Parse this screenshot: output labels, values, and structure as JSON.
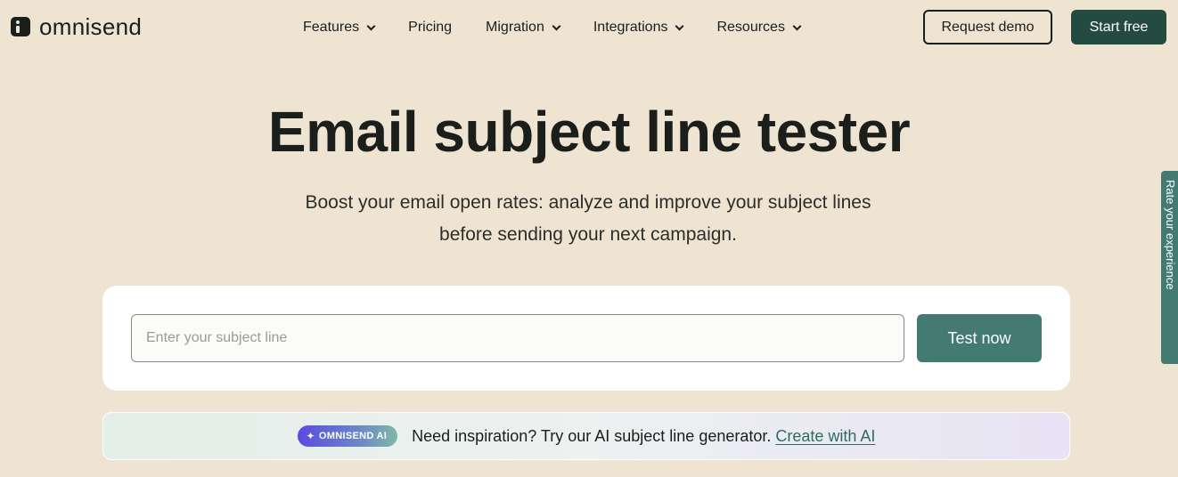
{
  "header": {
    "logo_text": "omnisend",
    "nav": [
      {
        "label": "Features",
        "has_dropdown": true
      },
      {
        "label": "Pricing",
        "has_dropdown": false
      },
      {
        "label": "Migration",
        "has_dropdown": true
      },
      {
        "label": "Integrations",
        "has_dropdown": true
      },
      {
        "label": "Resources",
        "has_dropdown": true
      }
    ],
    "request_demo_label": "Request demo",
    "start_free_label": "Start free"
  },
  "hero": {
    "title": "Email subject line tester",
    "subtitle": "Boost your email open rates: analyze and improve your subject lines before sending your next campaign."
  },
  "tester": {
    "input_value": "",
    "input_placeholder": "Enter your subject line",
    "test_button_label": "Test now"
  },
  "ai_banner": {
    "badge_label": "OMNISEND AI",
    "text": "Need inspiration? Try our AI subject line generator.",
    "link_label": "Create with AI"
  },
  "feedback_tab": {
    "label": "Rate your experience"
  },
  "colors": {
    "page_bg": "#efe3d1",
    "brand_dark": "#234b40",
    "accent_teal": "#437a72",
    "text": "#1a1f1c"
  }
}
